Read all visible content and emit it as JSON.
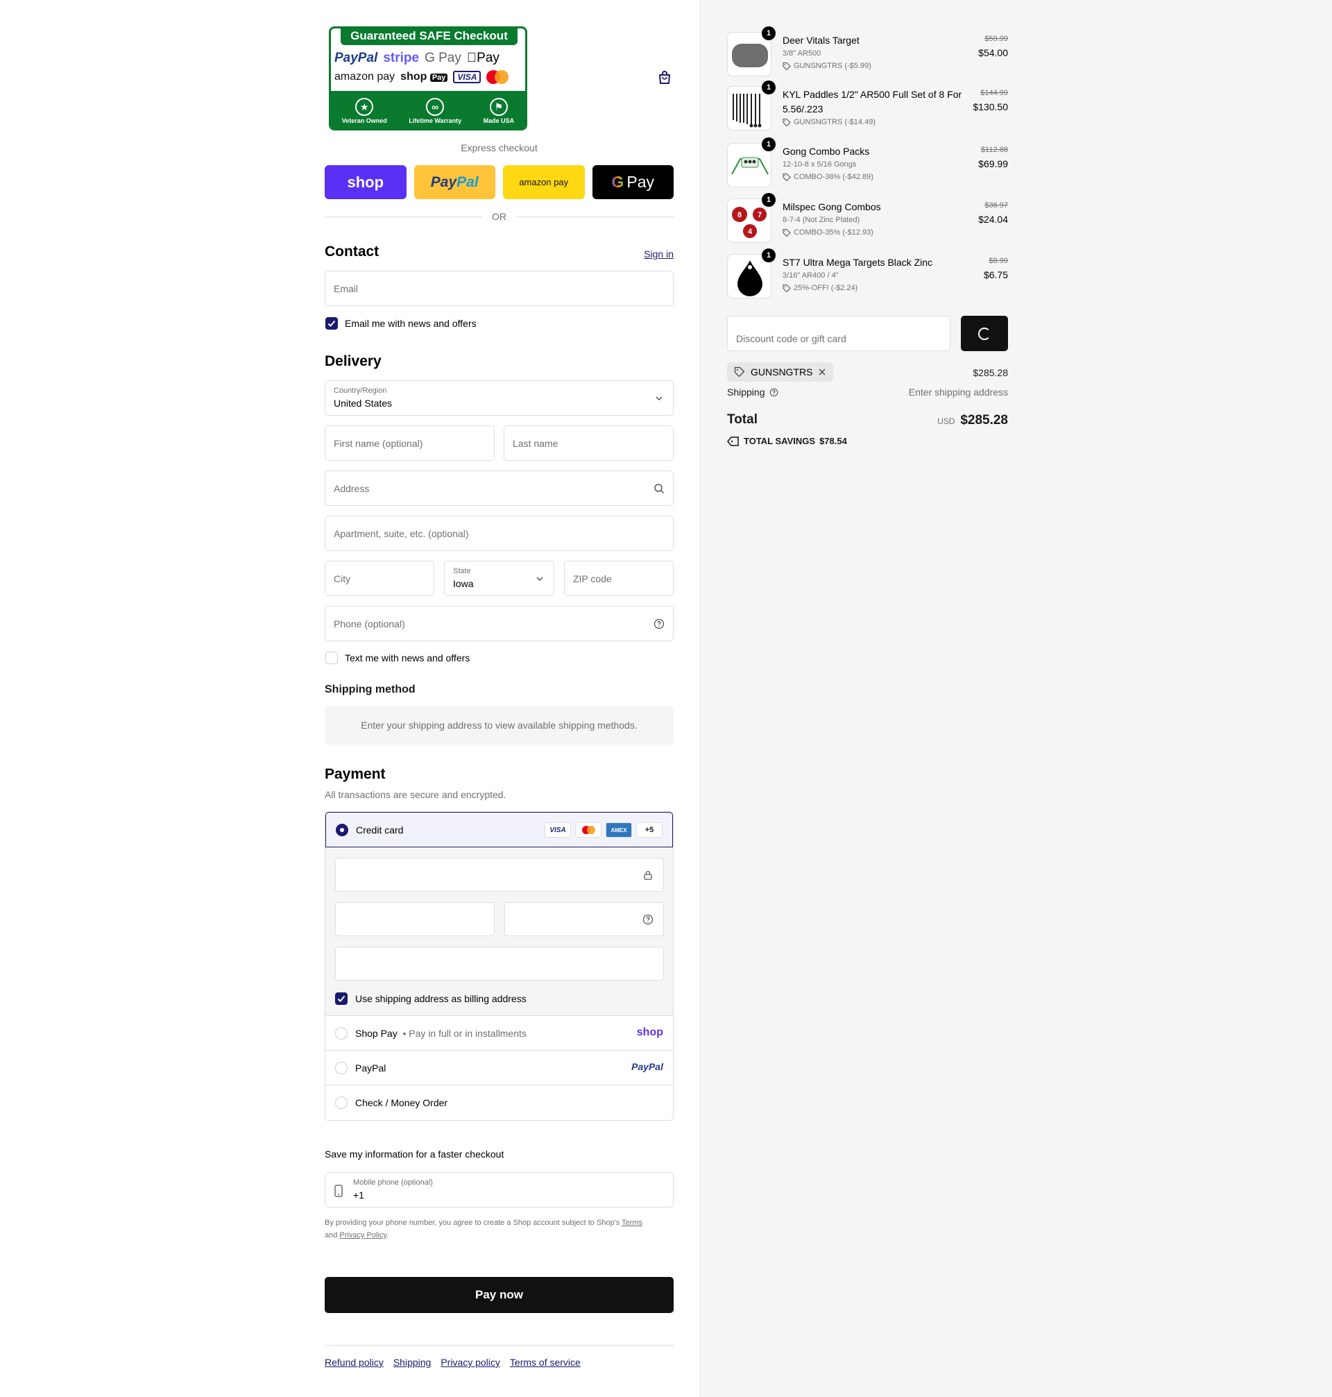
{
  "banner": {
    "title": "Guaranteed SAFE Checkout",
    "row1": [
      "PayPal",
      "stripe",
      "G Pay",
      "Pay"
    ],
    "row2": [
      "amazon pay",
      "shop",
      "Pay",
      "VISA"
    ],
    "badges": [
      {
        "label": "Veteran Owned"
      },
      {
        "label": "Lifetime Warranty"
      },
      {
        "label": "Made USA"
      }
    ]
  },
  "express": {
    "label": "Express checkout",
    "shop": "shop",
    "paypal_a": "Pay",
    "paypal_b": "Pal",
    "amazon": "amazon pay",
    "gpay": "Pay",
    "or": "OR"
  },
  "contact": {
    "heading": "Contact",
    "sign_in": "Sign in",
    "email_placeholder": "Email",
    "news_label": "Email me with news and offers"
  },
  "delivery": {
    "heading": "Delivery",
    "country_label": "Country/Region",
    "country_value": "United States",
    "first_name": "First name (optional)",
    "last_name": "Last name",
    "address": "Address",
    "apartment": "Apartment, suite, etc. (optional)",
    "city": "City",
    "state_label": "State",
    "state_value": "Iowa",
    "zip": "ZIP code",
    "phone": "Phone (optional)",
    "text_label": "Text me with news and offers"
  },
  "shipping_method": {
    "heading": "Shipping method",
    "message": "Enter your shipping address to view available shipping methods."
  },
  "payment": {
    "heading": "Payment",
    "subtext": "All transactions are secure and encrypted.",
    "credit_card": "Credit card",
    "card_logos": [
      "VISA",
      "MC",
      "AMEX",
      "+5"
    ],
    "billing_label": "Use shipping address as billing address",
    "shop_pay": "Shop Pay",
    "shop_pay_sub": "Pay in full or in installments",
    "shop_pay_logo": "shop",
    "paypal": "PayPal",
    "paypal_logo": "PayPal",
    "check": "Check / Money Order"
  },
  "save_info": {
    "label": "Save my information for a faster checkout",
    "phone_label": "Mobile phone (optional)",
    "phone_value": "+1",
    "legal_text": "By providing your phone number, you agree to create a Shop account subject to Shop's",
    "terms": "Terms",
    "and": "and",
    "privacy": "Privacy Policy",
    "period": "."
  },
  "pay_now": "Pay now",
  "footer": [
    "Refund policy",
    "Shipping",
    "Privacy policy",
    "Terms of service"
  ],
  "items": [
    {
      "qty": "1",
      "name": "Deer Vitals Target",
      "variant": "3/8\" AR500",
      "discount": "GUNSNGTRS (-$5.99)",
      "old_price": "$59.99",
      "price": "$54.00"
    },
    {
      "qty": "1",
      "name": "KYL Paddles 1/2\" AR500 Full Set of 8 For 5.56/.223",
      "variant": "",
      "discount": "GUNSNGTRS (-$14.49)",
      "old_price": "$144.99",
      "price": "$130.50"
    },
    {
      "qty": "1",
      "name": "Gong Combo Packs",
      "variant": "12-10-8 x 5/16 Gongs",
      "discount": "COMBO-38% (-$42.89)",
      "old_price": "$112.88",
      "price": "$69.99"
    },
    {
      "qty": "1",
      "name": "Milspec Gong Combos",
      "variant": "8-7-4 (Not Zinc Plated)",
      "discount": "COMBO-35% (-$12.93)",
      "old_price": "$36.97",
      "price": "$24.04"
    },
    {
      "qty": "1",
      "name": "ST7 Ultra Mega Targets Black Zinc",
      "variant": "3/16\" AR400 / 4\"",
      "discount": "25%-OFF! (-$2.24)",
      "old_price": "$8.99",
      "price": "$6.75"
    }
  ],
  "summary": {
    "discount_placeholder": "Discount code or gift card",
    "code": "GUNSNGTRS",
    "subtotal": "$285.28",
    "shipping_label": "Shipping",
    "shipping_value": "Enter shipping address",
    "total_label": "Total",
    "currency": "USD",
    "total": "$285.28",
    "savings_label": "TOTAL SAVINGS",
    "savings": "$78.54"
  },
  "colors": {
    "accent": "#1a1a6e",
    "shop": "#5a31f4",
    "paypal": "#ffc439",
    "amazon": "#ffd814",
    "banner_green": "#0a7a2f"
  }
}
